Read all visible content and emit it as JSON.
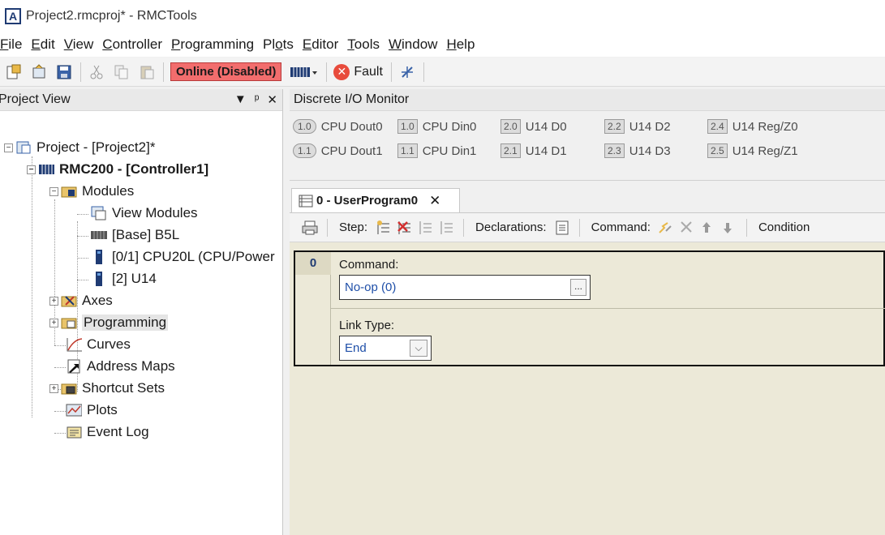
{
  "window": {
    "title": "Project2.rmcproj* - RMCTools",
    "logo_letter": "A"
  },
  "menu": [
    {
      "pre": "",
      "ul": "F",
      "post": "ile"
    },
    {
      "pre": "",
      "ul": "E",
      "post": "dit"
    },
    {
      "pre": "",
      "ul": "V",
      "post": "iew"
    },
    {
      "pre": "",
      "ul": "C",
      "post": "ontroller"
    },
    {
      "pre": "",
      "ul": "P",
      "post": "rogramming"
    },
    {
      "pre": "Pl",
      "ul": "o",
      "post": "ts"
    },
    {
      "pre": "",
      "ul": "E",
      "post": "ditor"
    },
    {
      "pre": "",
      "ul": "T",
      "post": "ools"
    },
    {
      "pre": "",
      "ul": "W",
      "post": "indow"
    },
    {
      "pre": "",
      "ul": "H",
      "post": "elp"
    }
  ],
  "toolbar": {
    "online_label": "Online (Disabled)",
    "fault_label": "Fault",
    "icons": [
      "new-project-icon",
      "open-project-icon",
      "save-icon",
      "cut-icon",
      "copy-icon",
      "paste-icon",
      "controller-icon",
      "fault-icon",
      "tools-icon"
    ],
    "colors": {
      "online_bg": "#f26d6d",
      "fault_red": "#e84b3c"
    }
  },
  "project_view": {
    "title": "Project View",
    "panel_buttons": [
      "▼",
      "ᵖ",
      "✕"
    ],
    "tree": {
      "root": "Project - [Project2]*",
      "controller": "RMC200 - [Controller1]",
      "modules": "Modules",
      "view_modules": "View Modules",
      "base": "[Base] B5L",
      "cpu": "[0/1] CPU20L (CPU/Power",
      "u14": "[2] U14",
      "axes": "Axes",
      "programming": "Programming",
      "curves": "Curves",
      "address_maps": "Address Maps",
      "shortcut_sets": "Shortcut Sets",
      "plots": "Plots",
      "event_log": "Event Log"
    }
  },
  "discrete_io": {
    "title": "Discrete I/O Monitor",
    "items": [
      {
        "badge": "1.0",
        "label": "CPU Dout0"
      },
      {
        "badge": "1.0",
        "label": "CPU Din0"
      },
      {
        "badge": "2.0",
        "label": "U14 D0"
      },
      {
        "badge": "2.2",
        "label": "U14 D2"
      },
      {
        "badge": "2.4",
        "label": "U14 Reg/Z0"
      },
      {
        "badge": "1.1",
        "label": "CPU Dout1"
      },
      {
        "badge": "1.1",
        "label": "CPU Din1"
      },
      {
        "badge": "2.1",
        "label": "U14 D1"
      },
      {
        "badge": "2.3",
        "label": "U14 D3"
      },
      {
        "badge": "2.5",
        "label": "U14 Reg/Z1"
      }
    ]
  },
  "program": {
    "tab_label": "0 - UserProgram0",
    "tab_close": "✕",
    "toolbar": {
      "step_label": "Step:",
      "declarations_label": "Declarations:",
      "command_label": "Command:",
      "condition_label": "Condition"
    },
    "step": {
      "number": "0",
      "command_label": "Command:",
      "command_value": "No-op (0)",
      "command_button": "...",
      "link_type_label": "Link Type:",
      "link_type_value": "End",
      "dropdown_glyph": "⌵"
    }
  }
}
